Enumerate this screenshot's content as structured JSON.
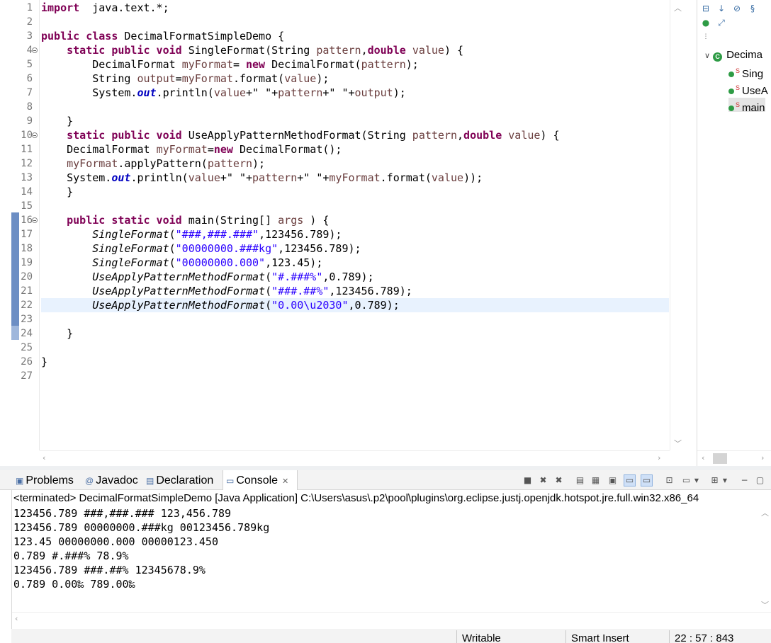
{
  "editor": {
    "lines": [
      {
        "n": "1",
        "segs": [
          [
            "kw",
            "import"
          ],
          [
            "",
            "  java.text.*;"
          ]
        ]
      },
      {
        "n": "2",
        "segs": []
      },
      {
        "n": "3",
        "segs": [
          [
            "kw",
            "public class"
          ],
          [
            "",
            " DecimalFormatSimpleDemo {"
          ]
        ]
      },
      {
        "n": "4",
        "fold": true,
        "segs": [
          [
            "",
            "    "
          ],
          [
            "kw",
            "static public void"
          ],
          [
            "",
            " SingleFormat(String "
          ],
          [
            "prm",
            "pattern"
          ],
          [
            ",",
            ""
          ],
          [
            "kw",
            "double"
          ],
          [
            "",
            " "
          ],
          [
            "prm",
            "value"
          ],
          [
            "",
            ") {"
          ]
        ]
      },
      {
        "n": "5",
        "segs": [
          [
            "",
            "        DecimalFormat "
          ],
          [
            "var",
            "myFormat"
          ],
          [
            "",
            "= "
          ],
          [
            "kw",
            "new"
          ],
          [
            "",
            " DecimalFormat("
          ],
          [
            "prm",
            "pattern"
          ],
          [
            "",
            ");"
          ]
        ]
      },
      {
        "n": "6",
        "segs": [
          [
            "",
            "        String "
          ],
          [
            "var",
            "output"
          ],
          [
            "",
            "="
          ],
          [
            "var",
            "myFormat"
          ],
          [
            "",
            ".format("
          ],
          [
            "prm",
            "value"
          ],
          [
            "",
            ");"
          ]
        ]
      },
      {
        "n": "7",
        "segs": [
          [
            "",
            "        System."
          ],
          [
            "fld",
            "out"
          ],
          [
            "",
            ".println("
          ],
          [
            "prm",
            "value"
          ],
          [
            "",
            "+\" \"+"
          ],
          [
            "prm",
            "pattern"
          ],
          [
            "",
            "+\" \"+"
          ],
          [
            "var",
            "output"
          ],
          [
            "",
            ");"
          ]
        ]
      },
      {
        "n": "8",
        "segs": []
      },
      {
        "n": "9",
        "segs": [
          [
            "",
            "    }"
          ]
        ]
      },
      {
        "n": "10",
        "fold": true,
        "segs": [
          [
            "",
            "    "
          ],
          [
            "kw",
            "static public void"
          ],
          [
            "",
            " UseApplyPatternMethodFormat(String "
          ],
          [
            "prm",
            "pattern"
          ],
          [
            ",",
            ""
          ],
          [
            "kw",
            "double"
          ],
          [
            "",
            " "
          ],
          [
            "prm",
            "value"
          ],
          [
            "",
            ") {"
          ]
        ]
      },
      {
        "n": "11",
        "segs": [
          [
            "",
            "    DecimalFormat "
          ],
          [
            "var",
            "myFormat"
          ],
          [
            "",
            "="
          ],
          [
            "kw",
            "new"
          ],
          [
            "",
            " DecimalFormat();"
          ]
        ]
      },
      {
        "n": "12",
        "segs": [
          [
            "",
            "    "
          ],
          [
            "var",
            "myFormat"
          ],
          [
            "",
            ".applyPattern("
          ],
          [
            "prm",
            "pattern"
          ],
          [
            "",
            ");"
          ]
        ]
      },
      {
        "n": "13",
        "segs": [
          [
            "",
            "    System."
          ],
          [
            "fld",
            "out"
          ],
          [
            "",
            ".println("
          ],
          [
            "prm",
            "value"
          ],
          [
            "",
            "+\" \"+"
          ],
          [
            "prm",
            "pattern"
          ],
          [
            "",
            "+\" \"+"
          ],
          [
            "var",
            "myFormat"
          ],
          [
            "",
            ".format("
          ],
          [
            "prm",
            "value"
          ],
          [
            "",
            "));"
          ]
        ]
      },
      {
        "n": "14",
        "segs": [
          [
            "",
            "    }"
          ]
        ]
      },
      {
        "n": "15",
        "segs": []
      },
      {
        "n": "16",
        "fold": true,
        "segs": [
          [
            "",
            "    "
          ],
          [
            "kw",
            "public static void"
          ],
          [
            "",
            " main(String[] "
          ],
          [
            "prm",
            "args"
          ],
          [
            "",
            " ) {"
          ]
        ]
      },
      {
        "n": "17",
        "segs": [
          [
            "",
            "        "
          ],
          [
            "ital",
            "SingleFormat"
          ],
          [
            "",
            "("
          ],
          [
            "str",
            "\"###,###.###\""
          ],
          [
            "",
            ",123456.789);"
          ]
        ]
      },
      {
        "n": "18",
        "segs": [
          [
            "",
            "        "
          ],
          [
            "ital",
            "SingleFormat"
          ],
          [
            "",
            "("
          ],
          [
            "str",
            "\"00000000.###kg\""
          ],
          [
            "",
            ",123456.789);"
          ]
        ]
      },
      {
        "n": "19",
        "segs": [
          [
            "",
            "        "
          ],
          [
            "ital",
            "SingleFormat"
          ],
          [
            "",
            "("
          ],
          [
            "str",
            "\"00000000.000\""
          ],
          [
            "",
            ",123.45);"
          ]
        ]
      },
      {
        "n": "20",
        "segs": [
          [
            "",
            "        "
          ],
          [
            "ital",
            "UseApplyPatternMethodFormat"
          ],
          [
            "",
            "("
          ],
          [
            "str",
            "\"#.###%\""
          ],
          [
            "",
            ",0.789);"
          ]
        ]
      },
      {
        "n": "21",
        "segs": [
          [
            "",
            "        "
          ],
          [
            "ital",
            "UseApplyPatternMethodFormat"
          ],
          [
            "",
            "("
          ],
          [
            "str",
            "\"###.##%\""
          ],
          [
            "",
            ",123456.789);"
          ]
        ]
      },
      {
        "n": "22",
        "current": true,
        "segs": [
          [
            "",
            "        "
          ],
          [
            "ital",
            "UseApplyPatternMethodFormat"
          ],
          [
            "",
            "("
          ],
          [
            "str",
            "\"0.00\\u2030\""
          ],
          [
            "",
            ",0.789);"
          ]
        ]
      },
      {
        "n": "23",
        "segs": []
      },
      {
        "n": "24",
        "segs": [
          [
            "",
            "    }"
          ]
        ]
      },
      {
        "n": "25",
        "segs": []
      },
      {
        "n": "26",
        "segs": [
          [
            "",
            "}"
          ]
        ]
      },
      {
        "n": "27",
        "segs": []
      }
    ]
  },
  "outline": {
    "class_label": "Decima",
    "items": [
      {
        "label": "Sing",
        "selected": false
      },
      {
        "label": "UseA",
        "selected": false
      },
      {
        "label": "main",
        "selected": true
      }
    ]
  },
  "bottom_panel": {
    "tabs": [
      {
        "label": "Problems",
        "icon": "problems-icon",
        "glyph": "▣"
      },
      {
        "label": "Javadoc",
        "icon": "javadoc-icon",
        "glyph": "@"
      },
      {
        "label": "Declaration",
        "icon": "declaration-icon",
        "glyph": "▤"
      },
      {
        "label": "Console",
        "icon": "console-icon",
        "glyph": "▭",
        "active": true,
        "close": "✕"
      }
    ],
    "terminated_line": "<terminated> DecimalFormatSimpleDemo [Java Application] C:\\Users\\asus\\.p2\\pool\\plugins\\org.eclipse.justj.openjdk.hotspot.jre.full.win32.x86_64",
    "output": [
      "123456.789 ###,###.### 123,456.789",
      "123456.789 00000000.###kg 00123456.789kg",
      "123.45 00000000.000 00000123.450",
      "0.789 #.###% 78.9%",
      "123456.789 ###.##% 12345678.9%",
      "0.789 0.00‰ 789.00‰"
    ]
  },
  "status": {
    "writable": "Writable",
    "insert_mode": "Smart Insert",
    "position": "22 : 57 : 843"
  }
}
